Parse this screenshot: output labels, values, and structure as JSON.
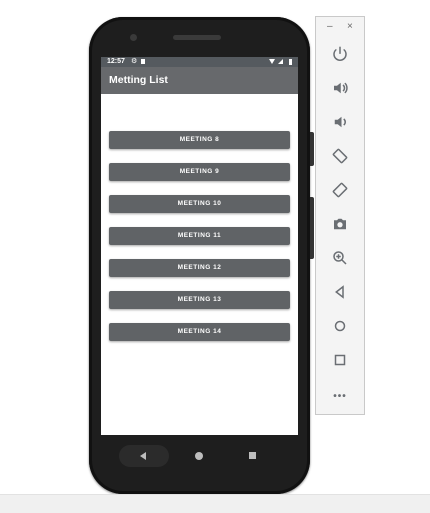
{
  "status_bar": {
    "time": "12:57"
  },
  "app": {
    "title": "Metting List"
  },
  "meetings": [
    {
      "label": "MEETING 8"
    },
    {
      "label": "MEETING 9"
    },
    {
      "label": "MEETING 10"
    },
    {
      "label": "MEETING 11"
    },
    {
      "label": "MEETING 12"
    },
    {
      "label": "MEETING 13"
    },
    {
      "label": "MEETING 14"
    }
  ],
  "emulator_panel": {
    "minimize": "–",
    "close": "×",
    "more": "•••",
    "tools": [
      "power-icon",
      "volume-up-icon",
      "volume-down-icon",
      "rotate-left-icon",
      "rotate-right-icon",
      "camera-icon",
      "zoom-icon",
      "back-icon",
      "home-icon",
      "overview-icon",
      "more-icon"
    ]
  },
  "colors": {
    "toolbar": "#67696c",
    "button": "#606366",
    "status_bar": "#555a5f",
    "phone_body": "#1e1e1e"
  }
}
